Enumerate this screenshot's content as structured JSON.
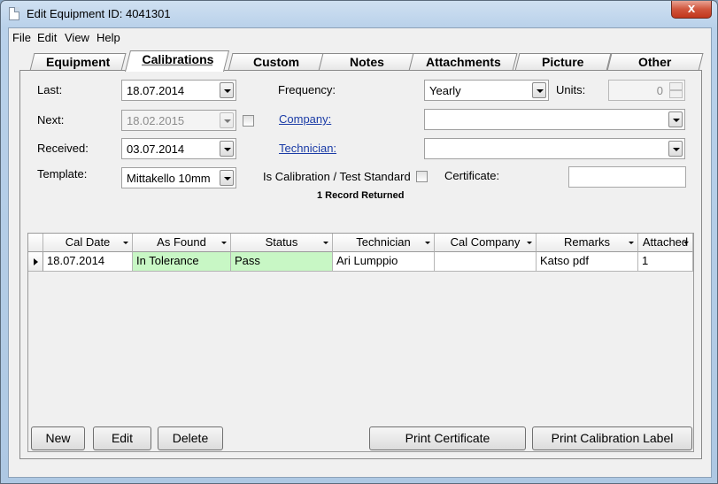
{
  "window": {
    "title": "Edit Equipment ID: 4041301",
    "close_label": "x"
  },
  "menu": [
    "File",
    "Edit",
    "View",
    "Help"
  ],
  "tabs": [
    "Equipment",
    "Calibrations",
    "Custom",
    "Notes",
    "Attachments",
    "Picture",
    "Other"
  ],
  "active_tab": "Calibrations",
  "form": {
    "last_label": "Last:",
    "last_value": "18.07.2014",
    "next_label": "Next:",
    "next_value": "18.02.2015",
    "received_label": "Received:",
    "received_value": "03.07.2014",
    "template_label": "Template:",
    "template_value": "Mittakello 10mm",
    "frequency_label": "Frequency:",
    "frequency_value": "Yearly",
    "units_label": "Units:",
    "units_value": "0",
    "company_label": "Company:",
    "company_value": "",
    "technician_label": "Technician:",
    "technician_value": "",
    "standard_label": "Is Calibration / Test Standard",
    "certificate_label": "Certificate:",
    "certificate_value": ""
  },
  "record_count": "1 Record Returned",
  "grid": {
    "columns": [
      "Cal Date",
      "As Found",
      "Status",
      "Technician",
      "Cal Company",
      "Remarks",
      "Attached"
    ],
    "rows": [
      [
        "18.07.2014",
        "In Tolerance",
        "Pass",
        "Ari Lumppio",
        "",
        "Katso pdf",
        "1"
      ]
    ]
  },
  "buttons": {
    "new": "New",
    "edit": "Edit",
    "delete": "Delete",
    "print_certificate": "Print Certificate",
    "print_label": "Print Calibration Label"
  }
}
